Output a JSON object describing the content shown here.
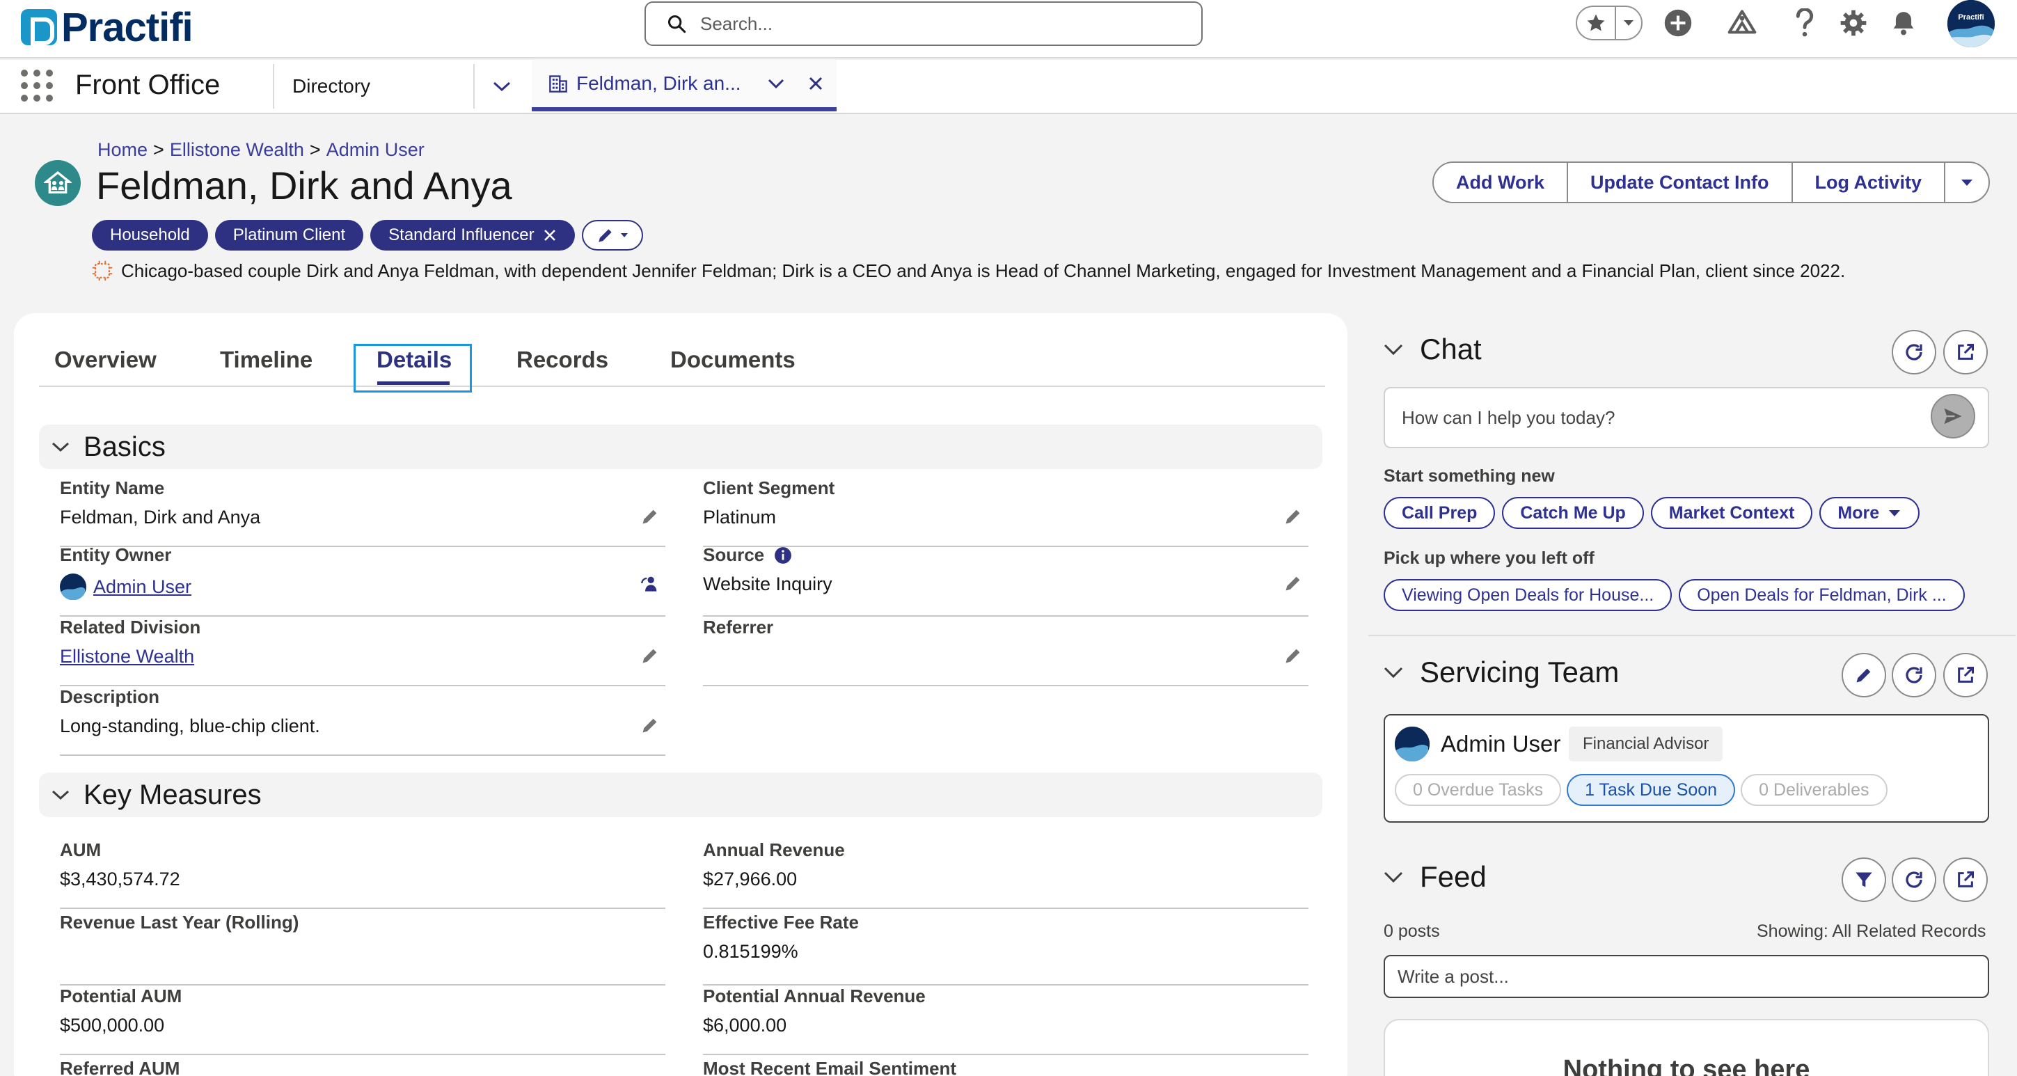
{
  "brand": {
    "name": "Practifi",
    "colors": {
      "primary": "#2e3182",
      "accent": "#1b96c8",
      "teal": "#2e8a8a"
    }
  },
  "header": {
    "search_placeholder": "Search...",
    "icons": [
      "star-icon",
      "chevron-down-icon",
      "add-icon",
      "trailhead-icon",
      "help-icon",
      "gear-icon",
      "bell-icon",
      "avatar"
    ]
  },
  "nav": {
    "app_name": "Front Office",
    "directory_label": "Directory",
    "open_tab_label": "Feldman, Dirk an..."
  },
  "record": {
    "breadcrumb": [
      "Home",
      "Ellistone Wealth",
      "Admin User"
    ],
    "breadcrumb_sep": ">",
    "title": "Feldman, Dirk and Anya",
    "tags": [
      "Household",
      "Platinum Client",
      "Standard Influencer"
    ],
    "summary": "Chicago-based couple Dirk and Anya Feldman, with dependent Jennifer Feldman; Dirk is a CEO and Anya is Head of Channel Marketing, engaged for Investment Management and a Financial Plan, client since 2022.",
    "actions": [
      "Add Work",
      "Update Contact Info",
      "Log Activity"
    ]
  },
  "tabs": [
    "Overview",
    "Timeline",
    "Details",
    "Records",
    "Documents"
  ],
  "active_tab": "Details",
  "basics": {
    "title": "Basics",
    "fields": {
      "entity_name": {
        "label": "Entity Name",
        "value": "Feldman, Dirk and Anya"
      },
      "client_segment": {
        "label": "Client Segment",
        "value": "Platinum"
      },
      "entity_owner": {
        "label": "Entity Owner",
        "value": "Admin User"
      },
      "source": {
        "label": "Source",
        "value": "Website Inquiry"
      },
      "related_division": {
        "label": "Related Division",
        "value": "Ellistone Wealth"
      },
      "referrer": {
        "label": "Referrer",
        "value": ""
      },
      "description": {
        "label": "Description",
        "value": "Long-standing, blue-chip client."
      }
    }
  },
  "key_measures": {
    "title": "Key Measures",
    "fields": {
      "aum": {
        "label": "AUM",
        "value": "$3,430,574.72"
      },
      "annual_revenue": {
        "label": "Annual Revenue",
        "value": "$27,966.00"
      },
      "revenue_last_year": {
        "label": "Revenue Last Year (Rolling)",
        "value": ""
      },
      "effective_fee_rate": {
        "label": "Effective Fee Rate",
        "value": "0.815199%"
      },
      "potential_aum": {
        "label": "Potential AUM",
        "value": "$500,000.00"
      },
      "potential_annual_revenue": {
        "label": "Potential Annual Revenue",
        "value": "$6,000.00"
      },
      "referred_aum": {
        "label": "Referred AUM",
        "value": ""
      },
      "email_sentiment": {
        "label": "Most Recent Email Sentiment",
        "value": ""
      }
    }
  },
  "chat": {
    "title": "Chat",
    "placeholder": "How can I help you today?",
    "start_heading": "Start something new",
    "start_actions": [
      "Call Prep",
      "Catch Me Up",
      "Market Context",
      "More"
    ],
    "resume_heading": "Pick up where you left off",
    "resume_items": [
      "Viewing Open Deals for House...",
      "Open Deals for Feldman, Dirk ..."
    ]
  },
  "servicing_team": {
    "title": "Servicing Team",
    "member_name": "Admin User",
    "member_role": "Financial Advisor",
    "chips": [
      "0 Overdue Tasks",
      "1 Task Due Soon",
      "0 Deliverables"
    ]
  },
  "feed": {
    "title": "Feed",
    "post_count": "0 posts",
    "showing": "Showing: All Related Records",
    "placeholder": "Write a post...",
    "empty_text": "Nothing to see here"
  }
}
